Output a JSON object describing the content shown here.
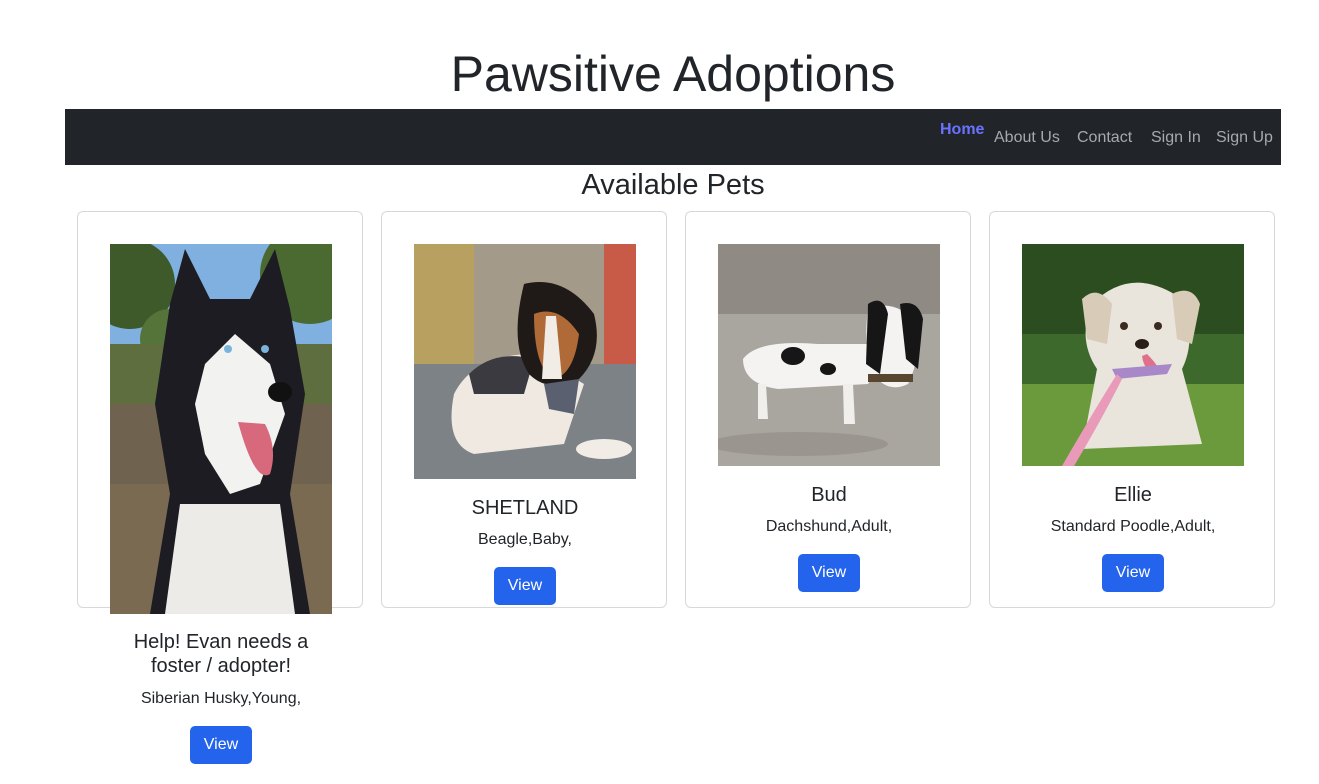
{
  "site": {
    "title": "Pawsitive Adoptions"
  },
  "nav": {
    "items": [
      {
        "label": "Home",
        "active": true
      },
      {
        "label": "About Us"
      },
      {
        "label": "Contact"
      },
      {
        "label": "Sign In"
      },
      {
        "label": "Sign Up"
      }
    ]
  },
  "main": {
    "section_title": "Available Pets",
    "pets": [
      {
        "name": "Help! Evan needs a foster / adopter!",
        "name_line1": "Help! Evan needs a",
        "name_line2": "foster / adopter!",
        "description": "Siberian Husky,Young,",
        "button": "View",
        "photo": "husky-photo"
      },
      {
        "name": "SHETLAND",
        "description": "Beagle,Baby,",
        "button": "View",
        "photo": "beagle-puppy-photo"
      },
      {
        "name": "Bud",
        "description": "Dachshund,Adult,",
        "button": "View",
        "photo": "dachshund-photo"
      },
      {
        "name": "Ellie",
        "description": "Standard Poodle,Adult,",
        "button": "View",
        "photo": "poodle-photo"
      }
    ]
  },
  "colors": {
    "navbar": "#212529",
    "nav_link": "#a7a9ac",
    "nav_active": "#6a72ff",
    "button": "#2463eb"
  }
}
